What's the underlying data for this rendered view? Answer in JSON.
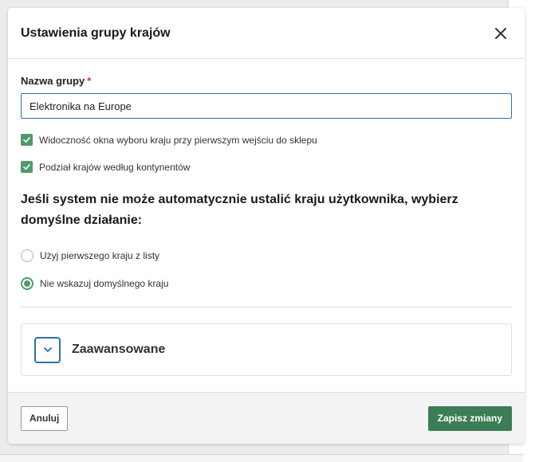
{
  "modal": {
    "title": "Ustawienia grupy krajów",
    "close_icon": "close-icon"
  },
  "group_name": {
    "label": "Nazwa grupy",
    "required_mark": "*",
    "value": "Elektronika na Europe"
  },
  "options": [
    {
      "label": "Widoczność okna wyboru kraju przy pierwszym wejściu do sklepu",
      "checked": true
    },
    {
      "label": "Podział krajów według kontynentów",
      "checked": true
    }
  ],
  "default_action": {
    "heading": "Jeśli system nie może automatycznie ustalić kraju użytkownika, wybierz domyślne działanie:",
    "choices": [
      {
        "label": "Użyj pierwszego kraju z listy",
        "selected": false
      },
      {
        "label": "Nie wskazuj domyślnego kraju",
        "selected": true
      }
    ]
  },
  "advanced": {
    "label": "Zaawansowane",
    "icon": "chevron-down-icon"
  },
  "footer": {
    "cancel_label": "Anuluj",
    "save_label": "Zapisz zmiany"
  },
  "colors": {
    "accent_green": "#4f9a6c",
    "save_button": "#3b7d55",
    "focus_blue": "#2f6eb5",
    "required_red": "#d0312d"
  }
}
